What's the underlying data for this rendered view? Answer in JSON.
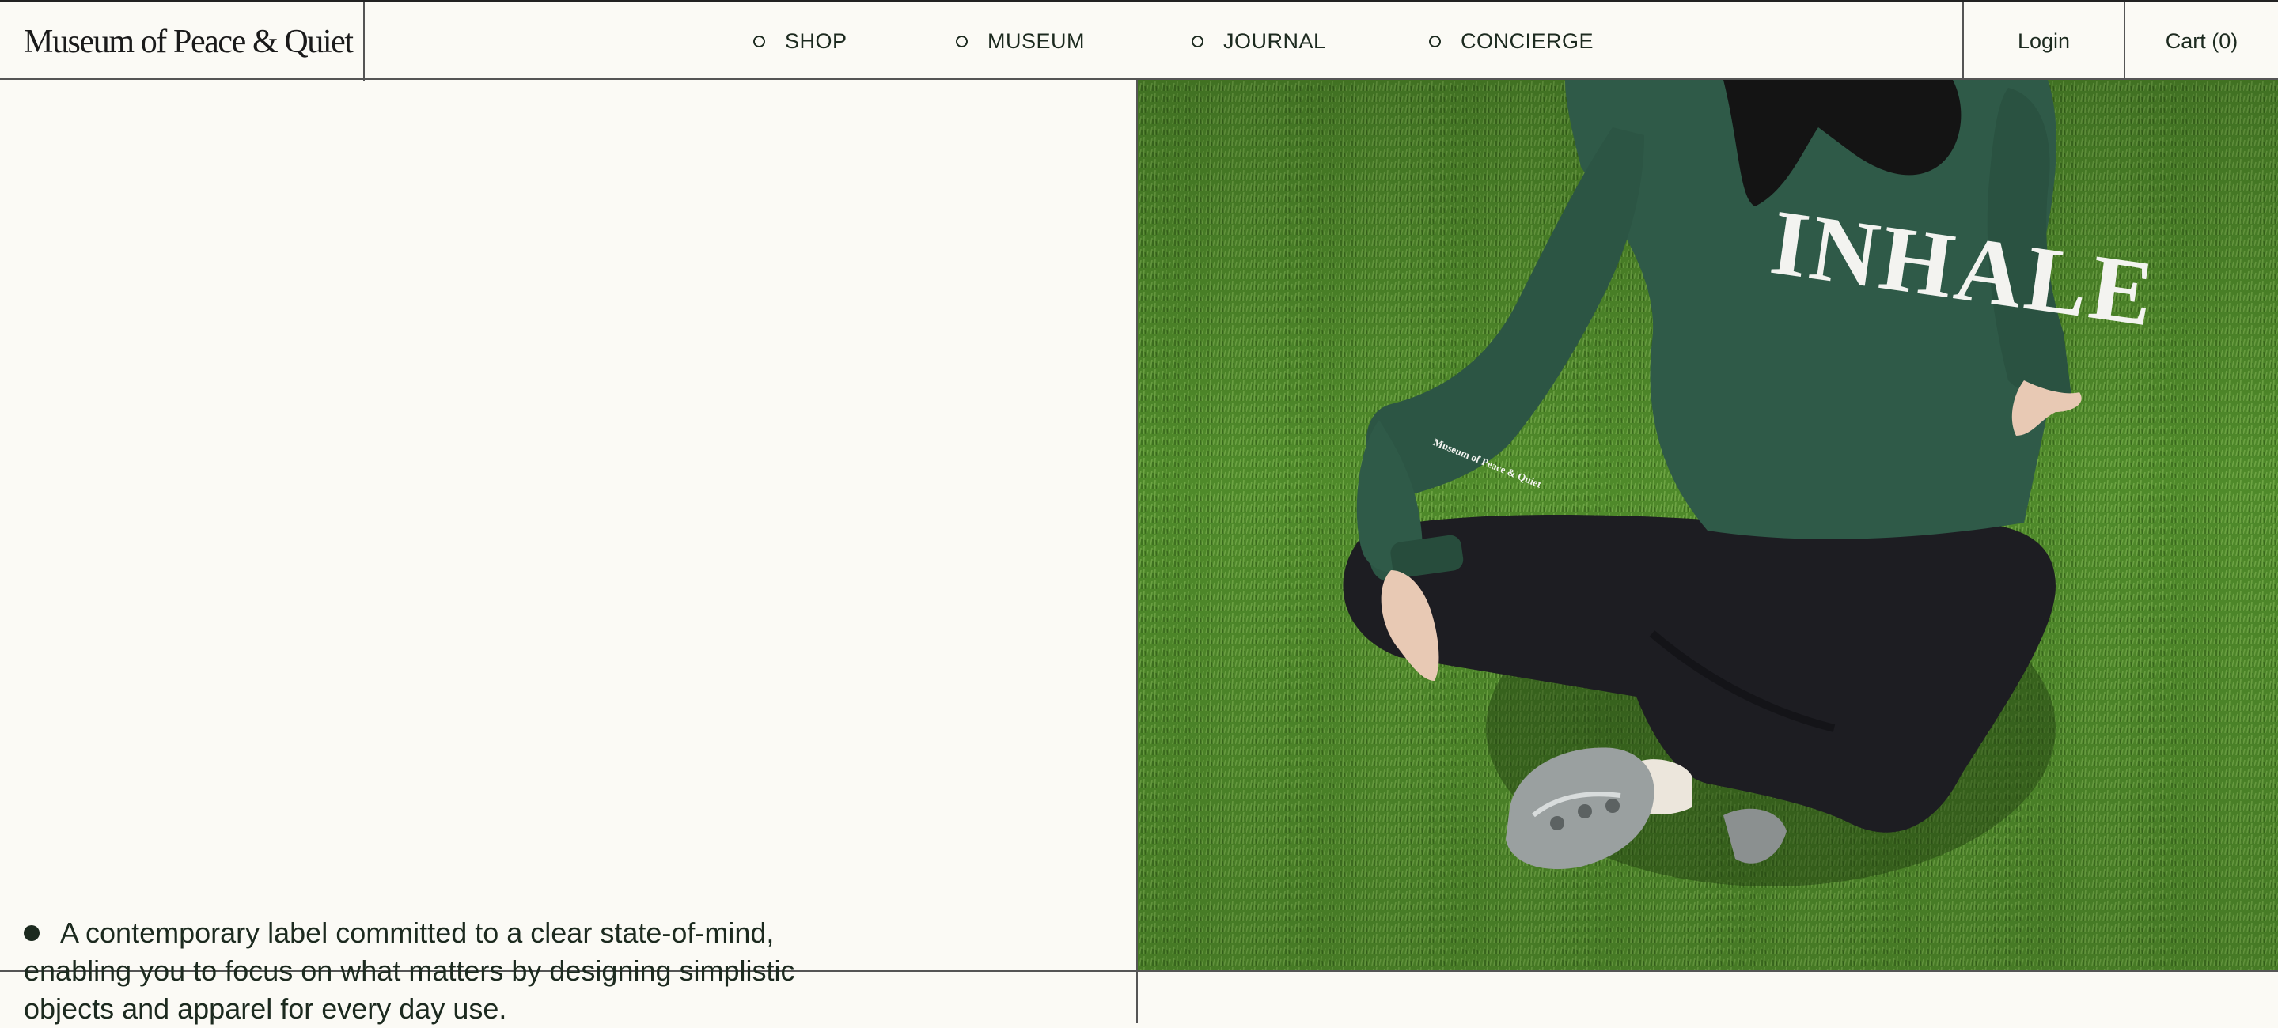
{
  "brand": {
    "name": "Museum of Peace & Quiet"
  },
  "nav": {
    "items": [
      {
        "label": "SHOP"
      },
      {
        "label": "MUSEUM"
      },
      {
        "label": "JOURNAL"
      },
      {
        "label": "CONCIERGE"
      }
    ]
  },
  "header": {
    "login_label": "Login",
    "cart_label": "Cart (0)"
  },
  "hero": {
    "tagline": "A contemporary label committed to a clear state-of-mind, enabling you to focus on what matters by designing simplistic objects and apparel for every day use.",
    "image": {
      "sweatshirt_text": "INHALE",
      "sleeve_text": "Museum of Peace & Quiet",
      "colors": {
        "grass": "#4f8a2a",
        "sweatshirt": "#2f5a48",
        "pants": "#1d1d22"
      }
    }
  },
  "colors": {
    "background": "#fbfaf5",
    "text": "#1c2a1f",
    "border": "#555555"
  }
}
